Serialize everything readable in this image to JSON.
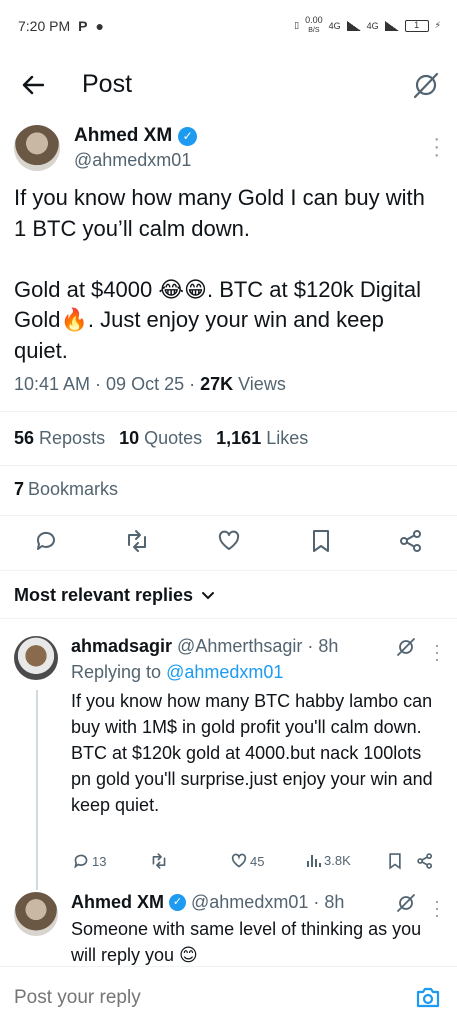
{
  "status_bar": {
    "time": "7:20 PM",
    "net_speed": "0.00",
    "net_unit": "B/S",
    "net1": "4G",
    "net2": "4G",
    "battery": "1"
  },
  "header": {
    "title": "Post"
  },
  "post": {
    "author_name": "Ahmed XM",
    "author_handle": "@ahmedxm01",
    "text": "If you know how many Gold I can buy with 1 BTC you’ll calm down.\n\nGold at $4000 😂😁. BTC at $120k Digital Gold🔥. Just enjoy your win and keep quiet.",
    "timestamp": "10:41 AM · 09 Oct 25 · ",
    "views_count": "27K",
    "views_label": " Views",
    "reposts_count": "56",
    "reposts_label": "Reposts",
    "quotes_count": "10",
    "quotes_label": "Quotes",
    "likes_count": "1,161",
    "likes_label": "Likes",
    "bookmarks_count": "7",
    "bookmarks_label": "Bookmarks"
  },
  "replies_filter": "Most relevant replies",
  "replies": [
    {
      "name": "ahmadsagir",
      "handle": "@Ahmerthsagir",
      "time": "· 8h",
      "replying_prefix": "Replying to ",
      "replying_to": "@ahmedxm01",
      "text": "If you know how many BTC habby lambo can buy with 1M$ in gold profit you'll calm down.\nBTC at $120k gold at 4000.but nack 100lots pn gold you'll surprise.just enjoy your win and keep quiet.",
      "replies_count": "13",
      "likes_count": "45",
      "views_count": "3.8K"
    },
    {
      "name": "Ahmed XM",
      "handle": "@ahmedxm01",
      "time": "· 8h",
      "text": "Someone with same level of thinking as you will reply you 😊"
    }
  ],
  "compose": {
    "placeholder": "Post your reply"
  },
  "icons": {
    "back": "arrow-left-icon",
    "grok": "grok-icon",
    "more": "more-vertical-icon",
    "reply": "reply-icon",
    "repost": "repost-icon",
    "like": "heart-icon",
    "bookmark": "bookmark-icon",
    "share": "share-icon",
    "camera": "camera-icon",
    "views": "views-chart-icon"
  },
  "colors": {
    "accent": "#1d9bf0",
    "text": "#0f1419",
    "muted": "#536471",
    "divider": "#eff3f4"
  }
}
